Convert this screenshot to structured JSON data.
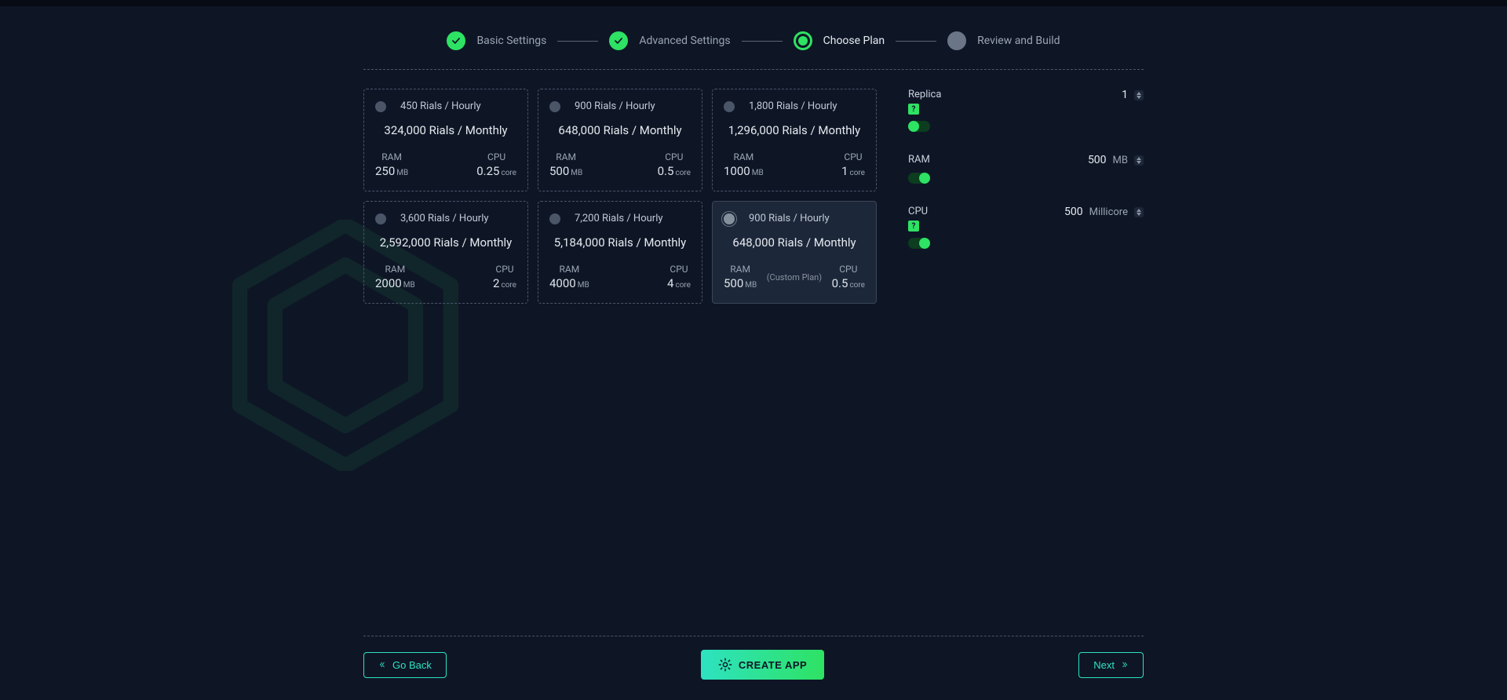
{
  "stepper": {
    "steps": [
      {
        "label": "Basic Settings",
        "state": "done"
      },
      {
        "label": "Advanced Settings",
        "state": "done"
      },
      {
        "label": "Choose Plan",
        "state": "current"
      },
      {
        "label": "Review and Build",
        "state": "future"
      }
    ]
  },
  "plans": [
    {
      "hourly": "450 Rials / Hourly",
      "monthly": "324,000 Rials / Monthly",
      "ram_val": "250",
      "ram_unit": "MB",
      "cpu_val": "0.25",
      "cpu_unit": "core",
      "selected": false,
      "custom": false
    },
    {
      "hourly": "900 Rials / Hourly",
      "monthly": "648,000 Rials / Monthly",
      "ram_val": "500",
      "ram_unit": "MB",
      "cpu_val": "0.5",
      "cpu_unit": "core",
      "selected": false,
      "custom": false
    },
    {
      "hourly": "1,800 Rials / Hourly",
      "monthly": "1,296,000 Rials / Monthly",
      "ram_val": "1000",
      "ram_unit": "MB",
      "cpu_val": "1",
      "cpu_unit": "core",
      "selected": false,
      "custom": false
    },
    {
      "hourly": "3,600 Rials / Hourly",
      "monthly": "2,592,000 Rials / Monthly",
      "ram_val": "2000",
      "ram_unit": "MB",
      "cpu_val": "2",
      "cpu_unit": "core",
      "selected": false,
      "custom": false
    },
    {
      "hourly": "7,200 Rials / Hourly",
      "monthly": "5,184,000 Rials / Monthly",
      "ram_val": "4000",
      "ram_unit": "MB",
      "cpu_val": "4",
      "cpu_unit": "core",
      "selected": false,
      "custom": false
    },
    {
      "hourly": "900 Rials / Hourly",
      "monthly": "648,000 Rials / Monthly",
      "ram_val": "500",
      "ram_unit": "MB",
      "cpu_val": "0.5",
      "cpu_unit": "core",
      "selected": true,
      "custom": true,
      "custom_label": "(Custom Plan)"
    }
  ],
  "spec_labels": {
    "ram": "RAM",
    "cpu": "CPU"
  },
  "controls": {
    "replica": {
      "label": "Replica",
      "value": "1",
      "help": true,
      "toggle": "left"
    },
    "ram": {
      "label": "RAM",
      "value": "500",
      "unit": "MB",
      "help": false,
      "toggle": "right"
    },
    "cpu": {
      "label": "CPU",
      "value": "500",
      "unit": "Millicore",
      "help": true,
      "toggle": "right"
    }
  },
  "footer": {
    "back": "Go Back",
    "create": "CREATE APP",
    "next": "Next"
  },
  "icons": {
    "help": "?"
  }
}
